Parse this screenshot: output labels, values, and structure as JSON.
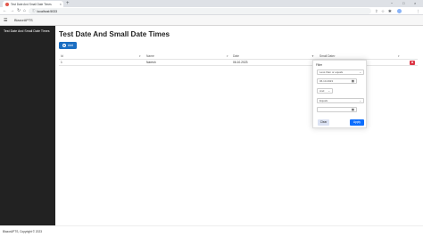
{
  "browser": {
    "tab_title": "Test Date And Small Date Times",
    "tab_close": "×",
    "new_tab": "+",
    "url": "localhost:5033",
    "window_controls": [
      "−",
      "□",
      "×"
    ]
  },
  "app": {
    "brand": "BlazorAPTS",
    "menu_icon": "☰"
  },
  "sidebar": {
    "items": [
      {
        "label": "Test Date And Small Date Times"
      }
    ]
  },
  "main": {
    "title": "Test Date And Small Date Times",
    "add_button": "Add"
  },
  "grid": {
    "columns": [
      {
        "label": "Id"
      },
      {
        "label": "Name"
      },
      {
        "label": "Date"
      },
      {
        "label": "Small Date"
      }
    ],
    "rows": [
      {
        "id": "1",
        "name": "Naresh",
        "date": "06.10.2023",
        "small_date": ""
      }
    ]
  },
  "filter": {
    "title": "Filter",
    "operator1": "Less than or equals",
    "value1": "06.10.2023",
    "logic": "And",
    "operator2": "Equals",
    "value2": "",
    "clear_label": "Clear",
    "apply_label": "Apply"
  },
  "footer": {
    "text": "BlazorAPTS, Copyright © 2023"
  },
  "colors": {
    "sidebar": "#222222",
    "primary": "#1b6ec2",
    "apply": "#0d6efd",
    "danger": "#dc3545"
  }
}
